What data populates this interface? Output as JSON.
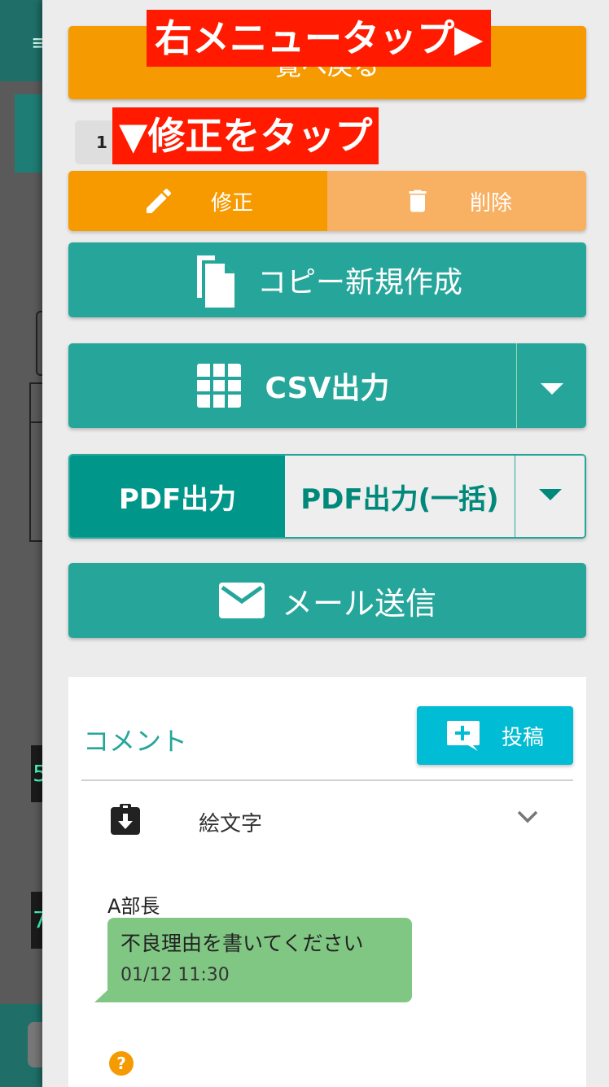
{
  "overlay": {
    "callout_top": "右メニュータップ▶",
    "callout_edit": "▼修正をタップ"
  },
  "background": {
    "menu_glyph": "≡",
    "char_1": "5",
    "char_2": "7"
  },
  "drawer": {
    "back_label": "覧へ戻る",
    "page_number": "1",
    "edit_label": "修正",
    "delete_label": "削除",
    "copy_label": "コピー新規作成",
    "csv_label": "CSV出力",
    "pdf_label": "PDF出力",
    "pdf_bulk_label": "PDF出力(一括)",
    "mail_label": "メール送信"
  },
  "comments": {
    "title": "コメント",
    "post_label": "投稿",
    "emoji_label": "絵文字",
    "items": [
      {
        "author": "A部長",
        "text": "不良理由を書いてください",
        "time": "01/12 11:30"
      }
    ],
    "help_glyph": "?"
  },
  "colors": {
    "teal": "#26a69a",
    "orange": "#f59a00",
    "orange_light": "#f8b062",
    "cyan": "#00bcd4",
    "bubble_green": "#81c784",
    "callout_red": "#ff1a00"
  }
}
